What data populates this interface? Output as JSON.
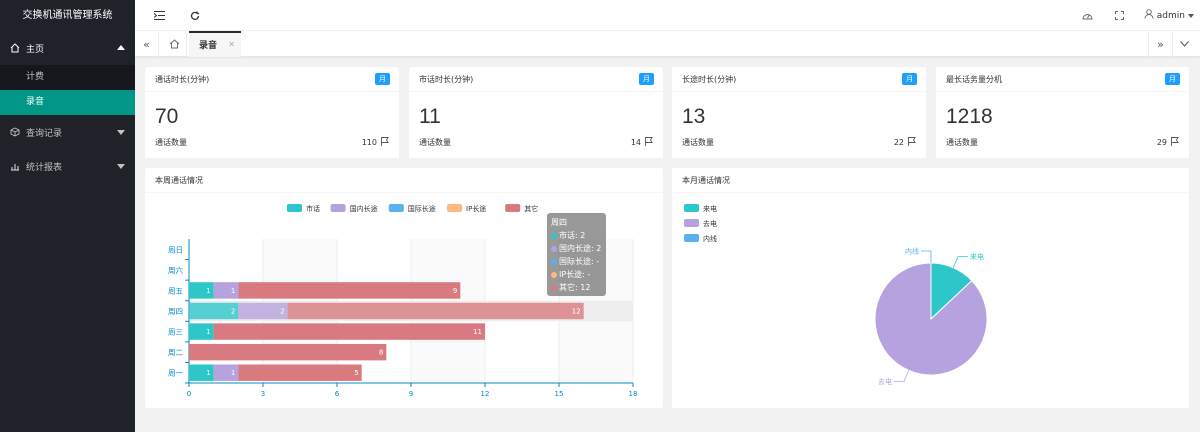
{
  "app": {
    "title": "交换机通讯管理系统"
  },
  "sidebar": {
    "items": [
      {
        "label": "主页",
        "icon": "home-icon",
        "open": true,
        "children": [
          {
            "label": "计费"
          },
          {
            "label": "录音",
            "active": true
          }
        ]
      },
      {
        "label": "查询记录",
        "icon": "cube-icon"
      },
      {
        "label": "统计报表",
        "icon": "bar-chart-icon"
      }
    ]
  },
  "header": {
    "user": "admin"
  },
  "tabs": {
    "active": "录音"
  },
  "cards": [
    {
      "title": "通话时长(分钟)",
      "badge": "月",
      "value": "70",
      "foot_label": "通话数量",
      "foot_value": "110"
    },
    {
      "title": "市话时长(分钟)",
      "badge": "月",
      "value": "11",
      "foot_label": "通话数量",
      "foot_value": "14"
    },
    {
      "title": "长途时长(分钟)",
      "badge": "月",
      "value": "13",
      "foot_label": "通话数量",
      "foot_value": "22"
    },
    {
      "title": "最长话务量分机",
      "badge": "月",
      "value": "1218",
      "foot_label": "通话数量",
      "foot_value": "29"
    }
  ],
  "weekly": {
    "title": "本周通话情况"
  },
  "monthly": {
    "title": "本月通话情况"
  },
  "colors": {
    "sidebar": "#20222a",
    "active": "#009688",
    "badge": "#1e9fff",
    "series": [
      "#2ec7c9",
      "#b6a2de",
      "#5ab1ef",
      "#ffb980",
      "#d87a80"
    ]
  },
  "chart_data": [
    {
      "type": "bar",
      "orientation": "horizontal",
      "stacked": true,
      "categories": [
        "周一",
        "周二",
        "周三",
        "周四",
        "周五",
        "周六",
        "周日"
      ],
      "series": [
        {
          "name": "市话",
          "values": [
            1,
            0,
            1,
            2,
            1,
            0,
            0
          ]
        },
        {
          "name": "国内长途",
          "values": [
            1,
            0,
            0,
            2,
            1,
            0,
            0
          ]
        },
        {
          "name": "国际长途",
          "values": [
            0,
            0,
            0,
            0,
            0,
            0,
            0
          ]
        },
        {
          "name": "IP长途",
          "values": [
            0,
            0,
            0,
            0,
            0,
            0,
            0
          ]
        },
        {
          "name": "其它",
          "values": [
            5,
            8,
            11,
            12,
            9,
            0,
            0
          ]
        }
      ],
      "xlim": [
        0,
        18
      ],
      "xticks": [
        0,
        3,
        6,
        9,
        12,
        15,
        18
      ],
      "legend": "top-center",
      "tooltip": {
        "title": "周四",
        "rows": [
          "市话: 2",
          "国内长途: 2",
          "国际长途: -",
          "IP长途: -",
          "其它: 12"
        ]
      }
    },
    {
      "type": "pie",
      "legend": "top-left",
      "series": [
        {
          "name": "来电",
          "value": 13
        },
        {
          "name": "去电",
          "value": 87
        },
        {
          "name": "内线",
          "value": 0
        }
      ]
    }
  ]
}
